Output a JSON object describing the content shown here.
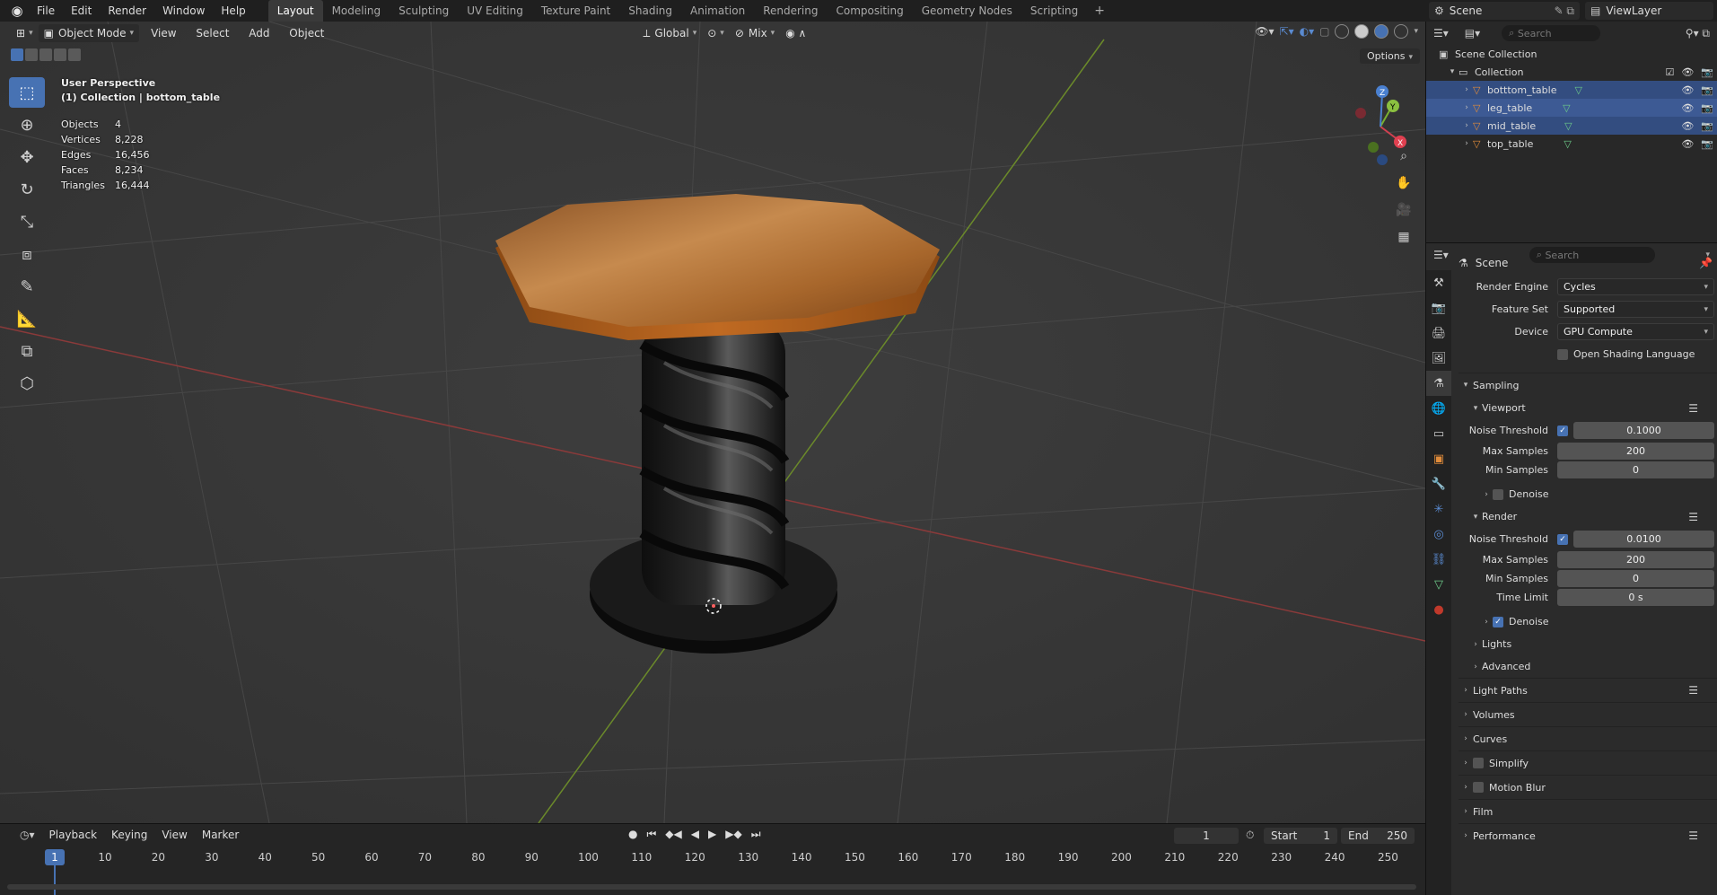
{
  "topbar": {
    "menus": [
      "File",
      "Edit",
      "Render",
      "Window",
      "Help"
    ],
    "workspaces": [
      "Layout",
      "Modeling",
      "Sculpting",
      "UV Editing",
      "Texture Paint",
      "Shading",
      "Animation",
      "Rendering",
      "Compositing",
      "Geometry Nodes",
      "Scripting"
    ],
    "active_workspace": "Layout",
    "scene": "Scene",
    "view_layer": "ViewLayer"
  },
  "viewport": {
    "mode": "Object Mode",
    "menus": [
      "View",
      "Select",
      "Add",
      "Object"
    ],
    "orientation": "Global",
    "snap": "Mix",
    "options_label": "Options",
    "perspective": "User Perspective",
    "context": "(1) Collection | bottom_table",
    "stats": [
      {
        "k": "Objects",
        "v": "4"
      },
      {
        "k": "Vertices",
        "v": "8,228"
      },
      {
        "k": "Edges",
        "v": "16,456"
      },
      {
        "k": "Faces",
        "v": "8,234"
      },
      {
        "k": "Triangles",
        "v": "16,444"
      }
    ]
  },
  "timeline": {
    "menus": [
      "Playback",
      "Keying",
      "View",
      "Marker"
    ],
    "current_frame": "1",
    "start_label": "Start",
    "start": "1",
    "end_label": "End",
    "end": "250",
    "ticks": [
      "10",
      "20",
      "30",
      "40",
      "50",
      "60",
      "70",
      "80",
      "90",
      "100",
      "110",
      "120",
      "130",
      "140",
      "150",
      "160",
      "170",
      "180",
      "190",
      "200",
      "210",
      "220",
      "230",
      "240",
      "250"
    ]
  },
  "outliner": {
    "search_placeholder": "Search",
    "scene_collection": "Scene Collection",
    "collection": "Collection",
    "objects": [
      "botttom_table",
      "leg_table",
      "mid_table",
      "top_table"
    ]
  },
  "properties": {
    "search_placeholder": "Search",
    "scene": "Scene",
    "render_engine_label": "Render Engine",
    "render_engine": "Cycles",
    "feature_set_label": "Feature Set",
    "feature_set": "Supported",
    "device_label": "Device",
    "device": "GPU Compute",
    "osl_label": "Open Shading Language",
    "sampling": "Sampling",
    "viewport": "Viewport",
    "noise_threshold_label": "Noise Threshold",
    "vp_noise": "0.1000",
    "max_samples_label": "Max Samples",
    "vp_max": "200",
    "min_samples_label": "Min Samples",
    "vp_min": "0",
    "denoise_label": "Denoise",
    "render": "Render",
    "r_noise": "0.0100",
    "r_max": "200",
    "r_min": "0",
    "time_limit_label": "Time Limit",
    "time_limit": "0 s",
    "lights": "Lights",
    "advanced": "Advanced",
    "light_paths": "Light Paths",
    "volumes": "Volumes",
    "curves": "Curves",
    "simplify": "Simplify",
    "motion_blur": "Motion Blur",
    "film": "Film",
    "performance": "Performance"
  }
}
